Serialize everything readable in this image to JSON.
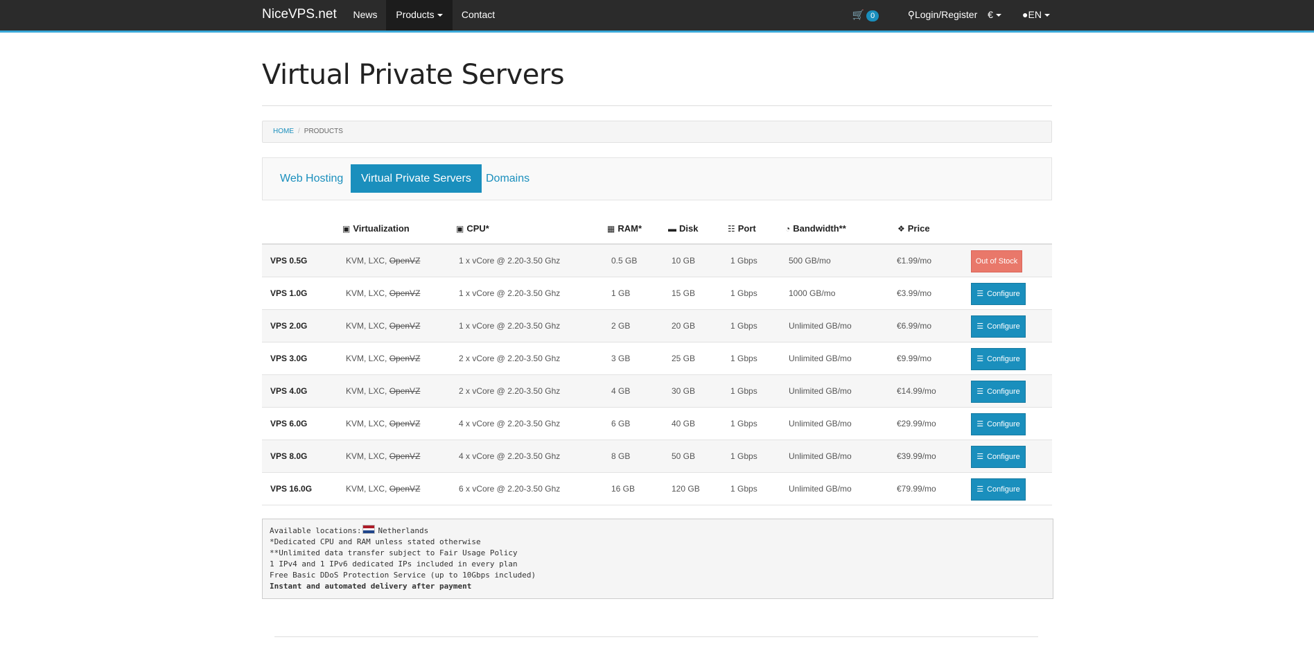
{
  "navbar": {
    "brand": "NiceVPS.net",
    "items": [
      {
        "label": "News"
      },
      {
        "label": "Products"
      },
      {
        "label": "Contact"
      }
    ],
    "cart_count": "0",
    "login": "Login/Register",
    "currency": "€",
    "language": "EN"
  },
  "page": {
    "title": "Virtual Private Servers"
  },
  "breadcrumb": {
    "home": "HOME",
    "current": "PRODUCTS"
  },
  "tabs": [
    {
      "label": "Web Hosting"
    },
    {
      "label": "Virtual Private Servers",
      "active": true
    },
    {
      "label": "Domains"
    }
  ],
  "table": {
    "headers": {
      "virtualization": "Virtualization",
      "cpu": "CPU*",
      "ram": "RAM*",
      "disk": "Disk",
      "port": "Port",
      "bandwidth": "Bandwidth**",
      "price": "Price"
    },
    "virt_prefix": "KVM, LXC,",
    "virt_struck": "OpenVZ",
    "rows": [
      {
        "name": "VPS 0.5G",
        "cpu": "1 x vCore @ 2.20-3.50 Ghz",
        "ram": "0.5 GB",
        "disk": "10 GB",
        "port": "1 Gbps",
        "bandwidth": "500 GB/mo",
        "price": "€1.99/mo",
        "action": "Out of Stock"
      },
      {
        "name": "VPS 1.0G",
        "cpu": "1 x vCore @ 2.20-3.50 Ghz",
        "ram": "1 GB",
        "disk": "15 GB",
        "port": "1 Gbps",
        "bandwidth": "1000 GB/mo",
        "price": "€3.99/mo",
        "action": "Configure"
      },
      {
        "name": "VPS 2.0G",
        "cpu": "1 x vCore @ 2.20-3.50 Ghz",
        "ram": "2 GB",
        "disk": "20 GB",
        "port": "1 Gbps",
        "bandwidth": "Unlimited GB/mo",
        "price": "€6.99/mo",
        "action": "Configure"
      },
      {
        "name": "VPS 3.0G",
        "cpu": "2 x vCore @ 2.20-3.50 Ghz",
        "ram": "3 GB",
        "disk": "25 GB",
        "port": "1 Gbps",
        "bandwidth": "Unlimited GB/mo",
        "price": "€9.99/mo",
        "action": "Configure"
      },
      {
        "name": "VPS 4.0G",
        "cpu": "2 x vCore @ 2.20-3.50 Ghz",
        "ram": "4 GB",
        "disk": "30 GB",
        "port": "1 Gbps",
        "bandwidth": "Unlimited GB/mo",
        "price": "€14.99/mo",
        "action": "Configure"
      },
      {
        "name": "VPS 6.0G",
        "cpu": "4 x vCore @ 2.20-3.50 Ghz",
        "ram": "6 GB",
        "disk": "40 GB",
        "port": "1 Gbps",
        "bandwidth": "Unlimited GB/mo",
        "price": "€29.99/mo",
        "action": "Configure"
      },
      {
        "name": "VPS 8.0G",
        "cpu": "4 x vCore @ 2.20-3.50 Ghz",
        "ram": "8 GB",
        "disk": "50 GB",
        "port": "1 Gbps",
        "bandwidth": "Unlimited GB/mo",
        "price": "€39.99/mo",
        "action": "Configure"
      },
      {
        "name": "VPS 16.0G",
        "cpu": "6 x vCore @ 2.20-3.50 Ghz",
        "ram": "16 GB",
        "disk": "120 GB",
        "port": "1 Gbps",
        "bandwidth": "Unlimited GB/mo",
        "price": "€79.99/mo",
        "action": "Configure"
      }
    ]
  },
  "notes": {
    "locations_label": "Available locations:",
    "location": "Netherlands",
    "lines": [
      "*Dedicated CPU and RAM unless stated otherwise",
      "**Unlimited data transfer subject to Fair Usage Policy",
      "1 IPv4 and 1 IPv6 dedicated IPs included in every plan",
      "Free Basic DDoS Protection Service (up to 10Gbps included)"
    ],
    "bold_line": "Instant and automated delivery after payment"
  }
}
